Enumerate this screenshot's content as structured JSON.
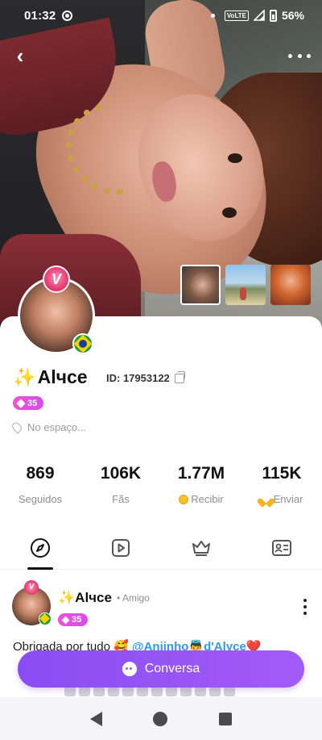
{
  "status_bar": {
    "time": "01:32",
    "network": "VoLTE",
    "battery": "56%"
  },
  "profile": {
    "name_sparkle": "✨",
    "name": "Alчce",
    "id_label": "ID: 17953122",
    "level": "35",
    "location": "No espaço...",
    "badge_letter": "V"
  },
  "stats": [
    {
      "value": "869",
      "label": "Seguidos"
    },
    {
      "value": "106K",
      "label": "Fãs"
    },
    {
      "value": "1.77M",
      "label": "Recibir"
    },
    {
      "value": "115K",
      "label": "Enviar"
    }
  ],
  "tabs": [
    {
      "icon": "compass-icon",
      "active": true
    },
    {
      "icon": "video-play-icon",
      "active": false
    },
    {
      "icon": "crown-icon",
      "active": false
    },
    {
      "icon": "id-card-icon",
      "active": false
    }
  ],
  "post": {
    "author_sparkle": "✨",
    "author": "Alчce",
    "relation": "• Amigo",
    "level": "35",
    "text_start": "Obrigada por tudo",
    "emoji_1": "🥰",
    "mention": "@Anjinho👼",
    "mention_2": "d'Alyce",
    "emoji_2": "❤️"
  },
  "cta": {
    "label": "Conversa"
  },
  "colors": {
    "accent_purple": "#9d58f5",
    "level_badge": "#e24fe6",
    "mention_blue": "#2f9be6",
    "coin_gold": "#f6c22c"
  }
}
